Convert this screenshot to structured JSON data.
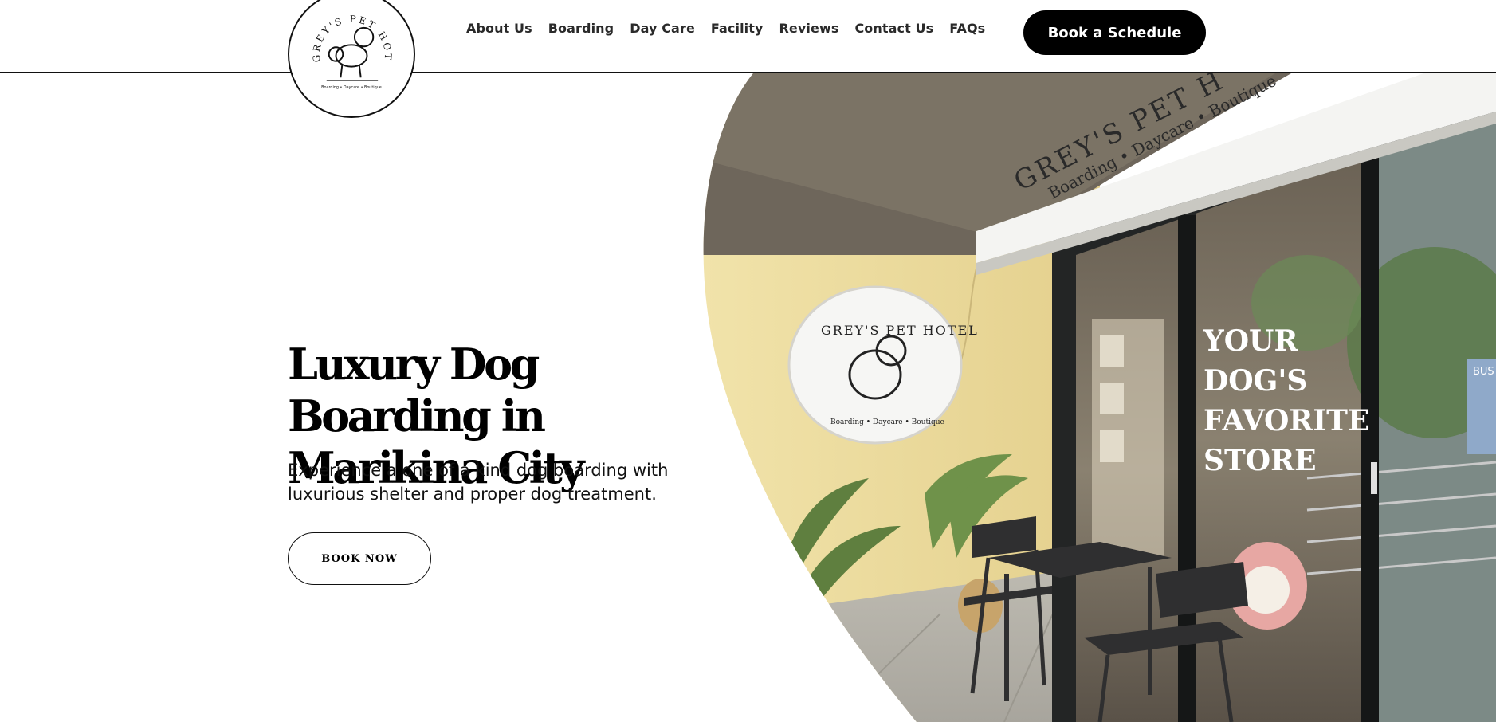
{
  "brand": {
    "logo_ring_text": "GREY'S PET HOTEL",
    "logo_tagline": "Boarding • Daycare • Boutique"
  },
  "nav": {
    "items": [
      {
        "label": "About Us"
      },
      {
        "label": "Boarding"
      },
      {
        "label": "Day Care"
      },
      {
        "label": "Facility"
      },
      {
        "label": "Reviews"
      },
      {
        "label": "Contact Us"
      },
      {
        "label": "FAQs"
      }
    ],
    "cta_label": "Book a Schedule"
  },
  "hero": {
    "title_line1": "Luxury Dog Boarding in",
    "title_line2": "Marikina City",
    "subtitle_line1": "Experience a one of a kind dog boarding with",
    "subtitle_line2": "luxurious shelter and proper dog treatment.",
    "button_label": "BOOK NOW"
  },
  "photo": {
    "awning_line1": "GREY'S PET H",
    "awning_line2": "Boarding • Daycare • Boutique",
    "sign_ring_text": "GREY'S PET HOTEL",
    "sign_tagline": "Boarding • Daycare • Boutique",
    "window_text": [
      "YOUR",
      "DOG'S",
      "FAVORITE",
      "STORE"
    ],
    "bus_sign": "BUS"
  },
  "colors": {
    "wall": "#efe1a6",
    "floor": "#b9b6ae",
    "dark_frame": "#1d1f1f",
    "accent": "#000000"
  }
}
